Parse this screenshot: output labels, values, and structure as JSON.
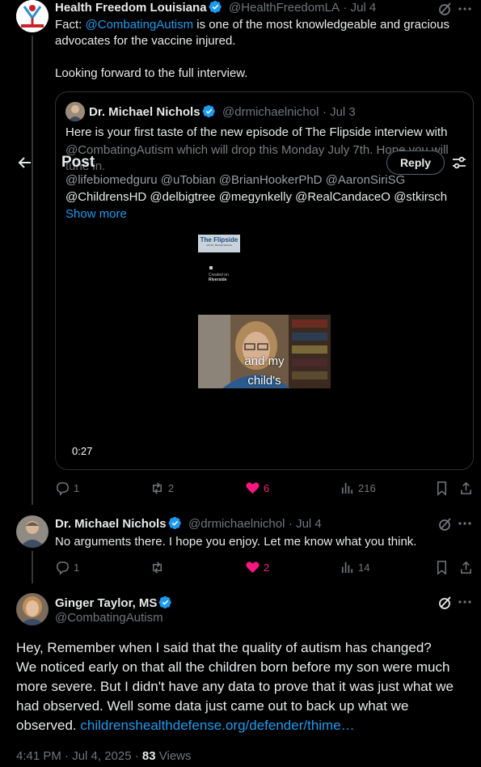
{
  "header": {
    "title": "Post",
    "reply_label": "Reply"
  },
  "tweet1": {
    "author": "Health Freedom Louisiana",
    "handle": "@HealthFreedomLA",
    "date": "· Jul 4",
    "text_prefix": "Fact: ",
    "mention": "@CombatingAutism",
    "text_suffix": " is one of the most knowledgeable and gracious advocates for the vaccine injured.",
    "text2": "Looking forward to the full interview.",
    "replies": "1",
    "reposts": "2",
    "likes": "6",
    "views": "216"
  },
  "quote": {
    "author": "Dr. Michael Nichols",
    "handle": "@drmichaelnichol",
    "date": "· Jul 3",
    "line1": "Here is your first taste of the new episode of The Flipside interview with",
    "line2": "@CombatingAutism which will drop this Monday July 7th.  Hope you will",
    "line3": "tune in.",
    "line4": "@lifebiomedguru @uTobian @BrianHookerPhD @AaronSiriSG",
    "line5": "@ChildrensHD @delbigtree @megynkelly @RealCandaceO @stkirsch",
    "show_more": "Show more",
    "video_time": "0:27",
    "slide_title": "The Flipside",
    "slide_sub": "with Dr. Michael Nichols",
    "slide_small1": "Created on",
    "slide_small2": "Riverside",
    "caption_line1": "and my",
    "caption_line2": "child's"
  },
  "tweet2": {
    "author": "Dr. Michael Nichols",
    "handle": "@drmichaelnichol",
    "date": "· Jul 4",
    "text": "No arguments there. I hope you enjoy. Let me know what you think.",
    "replies": "1",
    "reposts": "",
    "likes": "2",
    "views": "14"
  },
  "main": {
    "author": "Ginger Taylor, MS",
    "handle": "@CombatingAutism",
    "line1": "Hey,   Remember when I said that the quality of autism has changed?",
    "line2": "We noticed early on that all the children born before my son were much",
    "line3": "more severe.  But I didn't have any data to prove that it was just what we",
    "line4": "had observed.  Well some data just came out to back up what we",
    "line5_prefix": "observed.  ",
    "link": "childrenshealthdefense.org/defender/thime…",
    "timestamp": "4:41 PM · Jul 4, 2025 · ",
    "views_count": "83",
    "views_label": " Views"
  },
  "colors": {
    "background": "#000000",
    "text": "#e7e9ea",
    "muted": "#71767b",
    "link": "#1d9bf0",
    "like": "#f91880",
    "border": "#2f3336"
  }
}
